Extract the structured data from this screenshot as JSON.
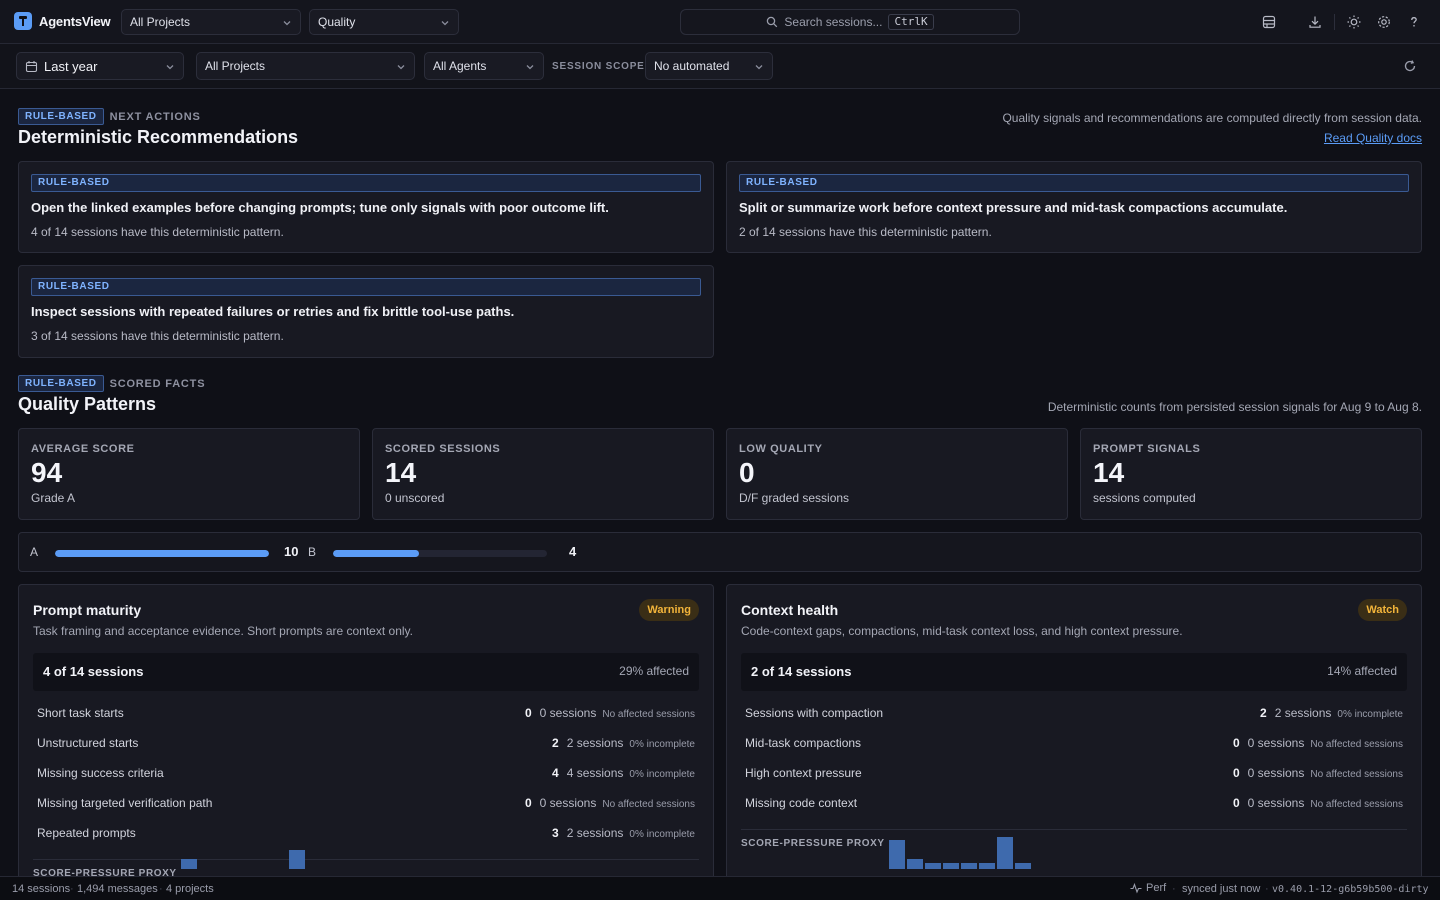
{
  "app": {
    "name": "AgentsView"
  },
  "topbar": {
    "project_select": "All Projects",
    "view_select": "Quality",
    "search_placeholder": "Search sessions...",
    "search_shortcut": "CtrlK",
    "icons": [
      "database-icon",
      "download-icon",
      "sun-icon",
      "gear-icon",
      "help-icon"
    ]
  },
  "filters": {
    "date_range": "Last year",
    "project": "All Projects",
    "agents": "All Agents",
    "scope_label": "SESSION SCOPE",
    "scope_value": "No automated"
  },
  "recommendations": {
    "badge": "RULE-BASED",
    "eyebrow": "NEXT ACTIONS",
    "title": "Deterministic Recommendations",
    "note": "Quality signals and recommendations are computed directly from session data.",
    "docs_link": "Read Quality docs",
    "cards": [
      {
        "badge": "RULE-BASED",
        "title": "Open the linked examples before changing prompts; tune only signals with poor outcome lift.",
        "subtitle": "4 of 14 sessions have this deterministic pattern."
      },
      {
        "badge": "RULE-BASED",
        "title": "Split or summarize work before context pressure and mid-task compactions accumulate.",
        "subtitle": "2 of 14 sessions have this deterministic pattern."
      },
      {
        "badge": "RULE-BASED",
        "title": "Inspect sessions with repeated failures or retries and fix brittle tool-use paths.",
        "subtitle": "3 of 14 sessions have this deterministic pattern."
      }
    ]
  },
  "patterns": {
    "badge": "RULE-BASED",
    "eyebrow": "SCORED FACTS",
    "title": "Quality Patterns",
    "note": "Deterministic counts from persisted session signals for Aug 9 to Aug 8.",
    "stats": [
      {
        "label": "AVERAGE SCORE",
        "value": "94",
        "sub": "Grade A"
      },
      {
        "label": "SCORED SESSIONS",
        "value": "14",
        "sub": "0 unscored"
      },
      {
        "label": "LOW QUALITY",
        "value": "0",
        "sub": "D/F graded sessions"
      },
      {
        "label": "PROMPT SIGNALS",
        "value": "14",
        "sub": "sessions computed"
      }
    ],
    "grades": [
      {
        "letter": "A",
        "count": "10",
        "fraction": 1.0
      },
      {
        "letter": "B",
        "count": "4",
        "fraction": 0.4
      }
    ]
  },
  "panels": [
    {
      "title": "Prompt maturity",
      "status": "Warning",
      "description": "Task framing and acceptance evidence. Short prompts are context only.",
      "summary": "4 of 14 sessions",
      "affected": "29% affected",
      "rows": [
        {
          "label": "Short task starts",
          "count": "0",
          "sessions": "0 sessions",
          "status": "No affected sessions"
        },
        {
          "label": "Unstructured starts",
          "count": "2",
          "sessions": "2 sessions",
          "status": "0% incomplete"
        },
        {
          "label": "Missing success criteria",
          "count": "4",
          "sessions": "4 sessions",
          "status": "0% incomplete"
        },
        {
          "label": "Missing targeted verification path",
          "count": "0",
          "sessions": "0 sessions",
          "status": "No affected sessions"
        },
        {
          "label": "Repeated prompts",
          "count": "3",
          "sessions": "2 sessions",
          "status": "0% incomplete"
        }
      ],
      "proxy_label": "SCORE-PRESSURE PROXY",
      "proxy_bars": [
        0.3,
        0,
        0,
        0,
        0,
        0,
        0.6,
        0
      ]
    },
    {
      "title": "Context health",
      "status": "Watch",
      "description": "Code-context gaps, compactions, mid-task context loss, and high context pressure.",
      "summary": "2 of 14 sessions",
      "affected": "14% affected",
      "rows": [
        {
          "label": "Sessions with compaction",
          "count": "2",
          "sessions": "2 sessions",
          "status": "0% incomplete"
        },
        {
          "label": "Mid-task compactions",
          "count": "0",
          "sessions": "0 sessions",
          "status": "No affected sessions"
        },
        {
          "label": "High context pressure",
          "count": "0",
          "sessions": "0 sessions",
          "status": "No affected sessions"
        },
        {
          "label": "Missing code context",
          "count": "0",
          "sessions": "0 sessions",
          "status": "No affected sessions"
        }
      ],
      "proxy_label": "SCORE-PRESSURE PROXY",
      "proxy_bars": [
        0.9,
        0.3,
        0.2,
        0.2,
        0.2,
        0.2,
        1.0,
        0.2
      ]
    }
  ],
  "footer": {
    "sessions": "14 sessions",
    "messages": "1,494 messages",
    "projects": "4 projects",
    "perf": "Perf",
    "sync": "synced just now",
    "version": "v0.40.1-12-g6b59b500-dirty"
  }
}
